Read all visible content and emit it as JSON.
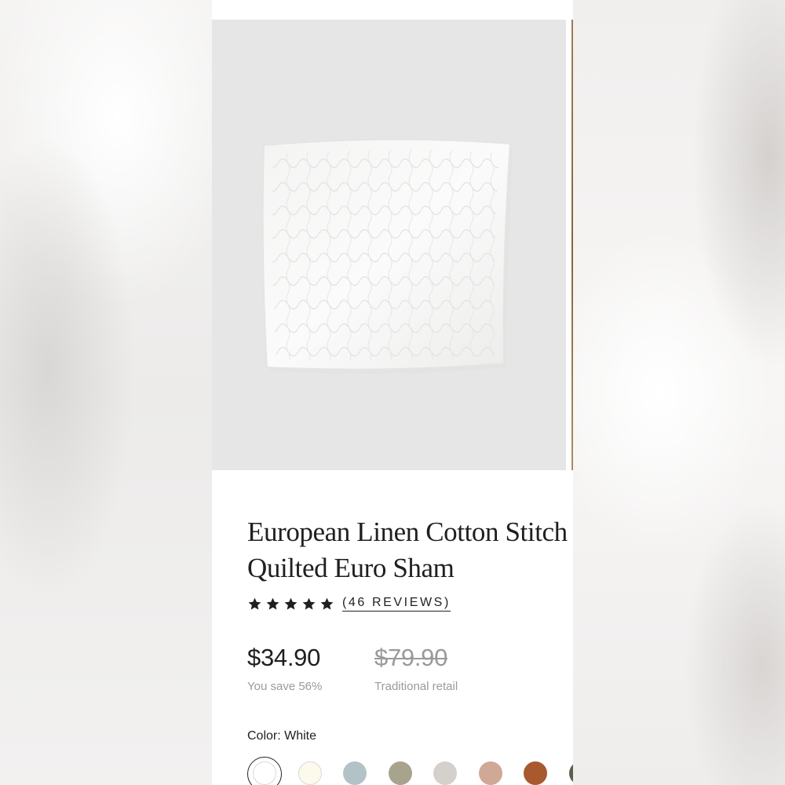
{
  "product": {
    "title_line1": "European Linen Cotton Stitch",
    "title_line2": "Quilted Euro Sham",
    "rating": 5,
    "reviews_label": "(46 REVIEWS)",
    "price": "$34.90",
    "savings": "You save 56%",
    "retail_price": "$79.90",
    "retail_label": "Traditional retail"
  },
  "color": {
    "label": "Color: White",
    "swatches": [
      {
        "name": "White",
        "hex": "#ffffff",
        "selected": true
      },
      {
        "name": "Ivory",
        "hex": "#fbfaec",
        "selected": false
      },
      {
        "name": "Blue",
        "hex": "#b3c2c7",
        "selected": false
      },
      {
        "name": "Olive",
        "hex": "#a7a38d",
        "selected": false
      },
      {
        "name": "Stone",
        "hex": "#d4d1cc",
        "selected": false
      },
      {
        "name": "Blush",
        "hex": "#cfa995",
        "selected": false
      },
      {
        "name": "Rust",
        "hex": "#a8592e",
        "selected": false
      },
      {
        "name": "Forest",
        "hex": "#5b5f4d",
        "selected": false
      }
    ]
  },
  "icons": {
    "star": "star-icon",
    "pillow": "pillow-image"
  }
}
